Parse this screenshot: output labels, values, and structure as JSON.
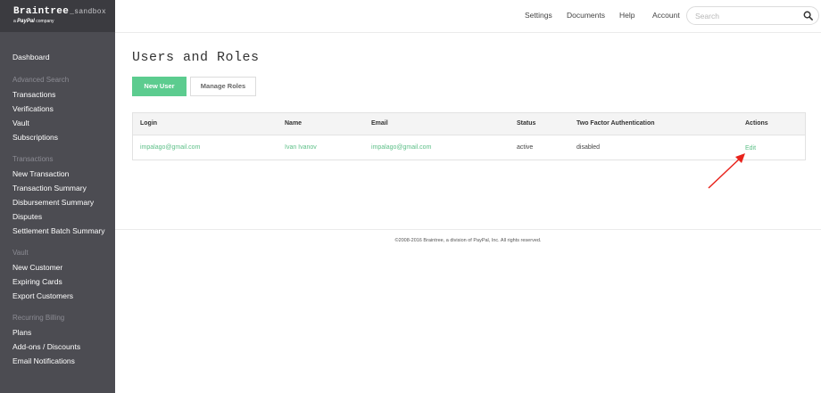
{
  "brand": {
    "name": "Braintree",
    "env": "_sandbox",
    "sub_prefix": "a",
    "sub_paypal": "PayPal",
    "sub_suffix": "company"
  },
  "sidebar": {
    "dashboard": "Dashboard",
    "sections": [
      {
        "heading": "Advanced Search",
        "items": [
          "Transactions",
          "Verifications",
          "Vault",
          "Subscriptions"
        ]
      },
      {
        "heading": "Transactions",
        "items": [
          "New Transaction",
          "Transaction Summary",
          "Disbursement Summary",
          "Disputes",
          "Settlement Batch Summary"
        ]
      },
      {
        "heading": "Vault",
        "items": [
          "New Customer",
          "Expiring Cards",
          "Export Customers"
        ]
      },
      {
        "heading": "Recurring Billing",
        "items": [
          "Plans",
          "Add-ons / Discounts",
          "Email Notifications"
        ]
      }
    ]
  },
  "topnav": {
    "settings": "Settings",
    "documents": "Documents",
    "help": "Help",
    "account": "Account",
    "search_placeholder": "Search"
  },
  "page": {
    "title": "Users and Roles",
    "new_user": "New User",
    "manage_roles": "Manage Roles"
  },
  "table": {
    "headers": {
      "login": "Login",
      "name": "Name",
      "email": "Email",
      "status": "Status",
      "two_factor": "Two Factor Authentication",
      "actions": "Actions"
    },
    "rows": [
      {
        "login": "impalago@gmail.com",
        "name": "Ivan Ivanov",
        "email": "impalago@gmail.com",
        "status": "active",
        "two_factor": "disabled",
        "action": "Edit"
      }
    ]
  },
  "footer": "©2008-2016 Braintree, a division of PayPal, Inc. All rights reserved.",
  "colors": {
    "accent": "#5ccc8f",
    "sidebar": "#4c4c52",
    "annotation_arrow": "#e8231c"
  }
}
